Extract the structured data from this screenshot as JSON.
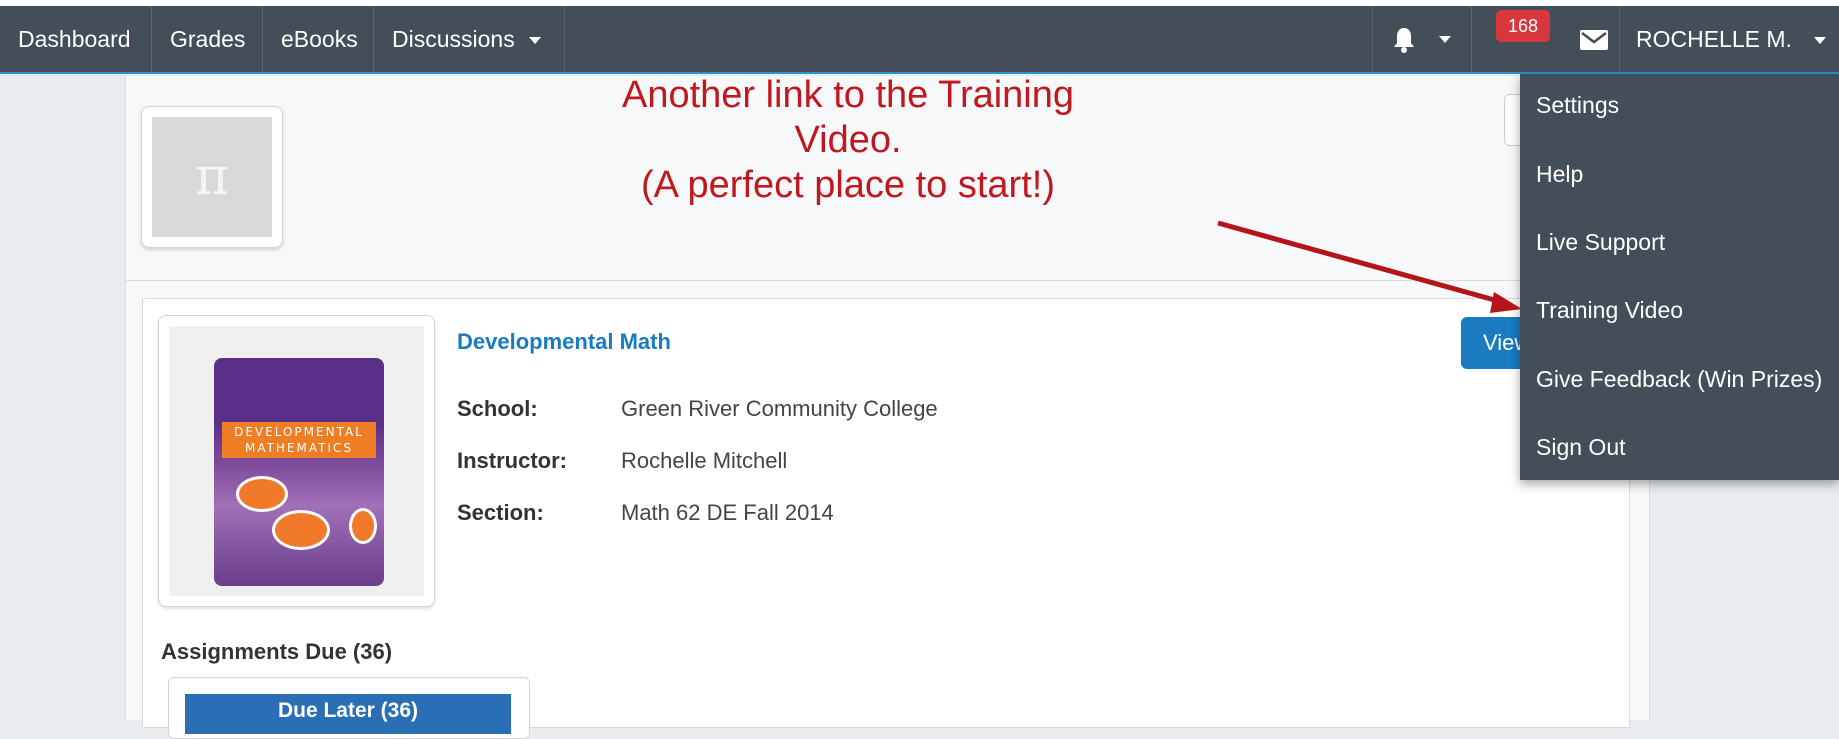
{
  "navbar": {
    "items": [
      {
        "label": "Dashboard"
      },
      {
        "label": "Grades"
      },
      {
        "label": "eBooks"
      },
      {
        "label": "Discussions"
      }
    ],
    "notification_count": "168",
    "user_name": "ROCHELLE M."
  },
  "header": {
    "icon_glyph": "π",
    "annotation_line1": "Another link to the Training Video.",
    "annotation_line2": "(A perfect place to start!)"
  },
  "course": {
    "title": "Developmental Math",
    "view_button": "View",
    "book_cover_title": "DEVELOPMENTAL MATHEMATICS",
    "fields": [
      {
        "label": "School:",
        "value": "Green River Community College"
      },
      {
        "label": "Instructor:",
        "value": "Rochelle Mitchell"
      },
      {
        "label": "Section:",
        "value": "Math 62 DE Fall 2014"
      }
    ]
  },
  "assignments": {
    "heading": "Assignments Due (36)",
    "due_later": "Due Later (36)"
  },
  "user_menu": {
    "items": [
      {
        "label": "Settings"
      },
      {
        "label": "Help"
      },
      {
        "label": "Live Support"
      },
      {
        "label": "Training Video"
      },
      {
        "label": "Give Feedback (Win Prizes)"
      },
      {
        "label": "Sign Out"
      }
    ]
  },
  "colors": {
    "navbar_bg": "#434e58",
    "accent_blue": "#1a7bc1",
    "badge_red": "#d9363e",
    "annotation_red": "#c0181f"
  },
  "icons": [
    "bell-icon",
    "caret-down-icon",
    "mail-icon",
    "pi-icon"
  ]
}
